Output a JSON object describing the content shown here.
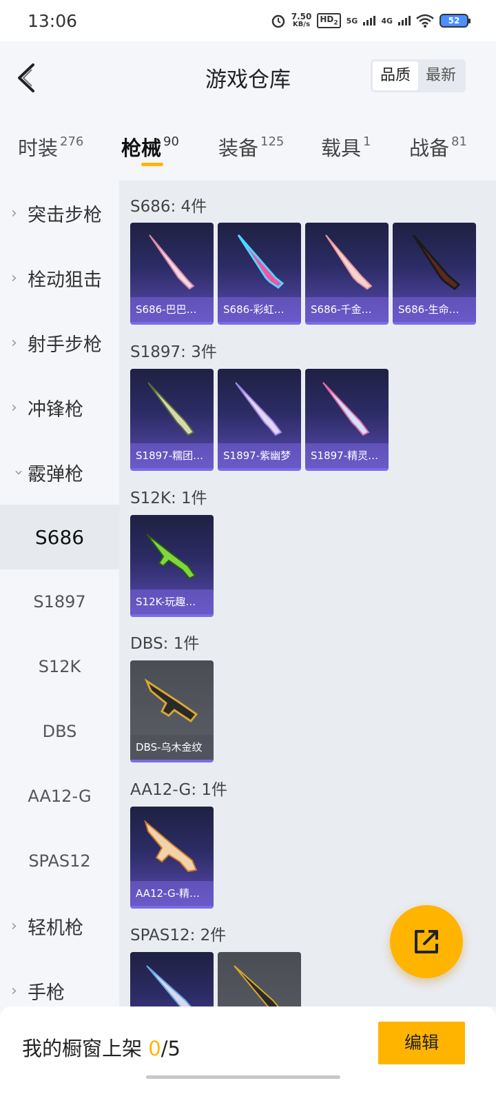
{
  "status": {
    "time": "13:06",
    "speed_top": "7.50",
    "speed_bottom": "KB/s",
    "hd": "HD",
    "hd_sub": "2",
    "sig1": "5G",
    "sig2": "4G",
    "battery": "52"
  },
  "header": {
    "title": "游戏仓库",
    "sort_options": [
      "品质",
      "最新"
    ],
    "active_sort": "品质"
  },
  "tabs": [
    {
      "label": "时装",
      "count": "276"
    },
    {
      "label": "枪械",
      "count": "90"
    },
    {
      "label": "装备",
      "count": "125"
    },
    {
      "label": "载具",
      "count": "1"
    },
    {
      "label": "战备",
      "count": "81"
    }
  ],
  "active_tab": "枪械",
  "sidebar": {
    "categories_top": [
      "突击步枪",
      "栓动狙击",
      "射手步枪",
      "冲锋枪"
    ],
    "expanded_category": "霰弹枪",
    "subcategories": [
      "S686",
      "S1897",
      "S12K",
      "DBS",
      "AA12-G",
      "SPAS12"
    ],
    "active_subcategory": "S686",
    "categories_bottom": [
      "轻机枪",
      "手枪"
    ]
  },
  "groups": [
    {
      "title": "S686: 4件",
      "items": [
        "S686-巴巴…",
        "S686-彩虹…",
        "S686-千金…",
        "S686-生命…"
      ]
    },
    {
      "title": "S1897: 3件",
      "items": [
        "S1897-糯团…",
        "S1897-紫幽梦",
        "S1897-精灵…"
      ]
    },
    {
      "title": "S12K: 1件",
      "items": [
        "S12K-玩趣…"
      ]
    },
    {
      "title": "DBS: 1件",
      "items": [
        "DBS-乌木金纹"
      ]
    },
    {
      "title": "AA12-G: 1件",
      "items": [
        "AA12-G-精…"
      ]
    },
    {
      "title": "SPAS12: 2件",
      "items": [
        "",
        ""
      ]
    }
  ],
  "colors": {
    "accent": "#ffb400",
    "card_purple": "#5a4bb0"
  },
  "icons": {
    "back": "chevron-left-icon",
    "fab": "share-external-icon"
  },
  "bottom": {
    "showcase_prefix": "我的橱窗上架",
    "showcase_count": "0",
    "showcase_total": "/5",
    "edit_label": "编辑"
  }
}
